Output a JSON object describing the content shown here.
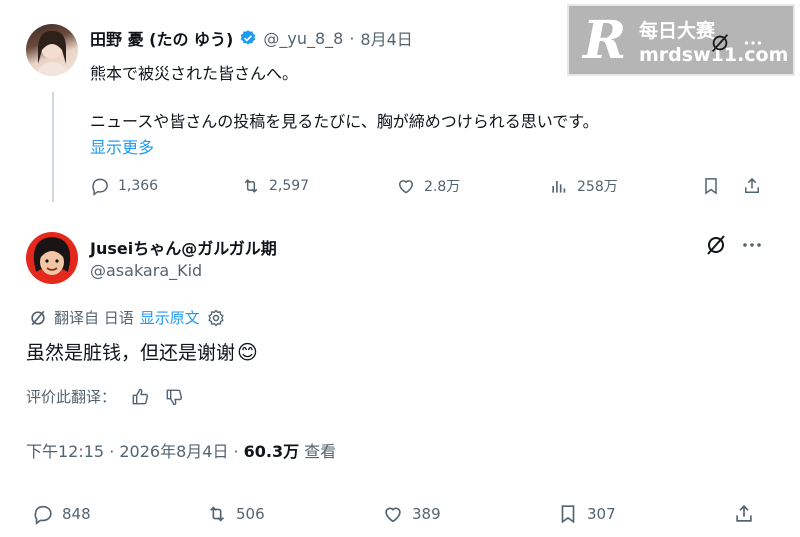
{
  "tweet": {
    "author_name": "田野 憂 (たの ゆう)",
    "handle": "@_yu_8_8",
    "separator": "·",
    "date": "8月4日",
    "text_line1": "熊本で被災された皆さんへ。",
    "text_line2": "ニュースや皆さんの投稿を見るたびに、胸が締めつけられる思いです。",
    "show_more": "显示更多",
    "replies": "1,366",
    "retweets": "2,597",
    "likes": "2.8万",
    "views": "258万"
  },
  "reply": {
    "author_name": "Juseiちゃん@ガルガル期",
    "handle": "@asakara_Kid",
    "translated_from": "翻译自 日语",
    "show_original": "显示原文",
    "text": "虽然是脏钱，但还是谢谢",
    "emoji": "😊",
    "rate_translation": "评价此翻译：",
    "time": "下午12:15 · 2026年8月4日 ·",
    "view_count": "60.3万",
    "view_label": "查看",
    "replies": "848",
    "retweets": "506",
    "likes": "389",
    "bookmarks": "307"
  },
  "watermark": {
    "logo_letter": "R",
    "title": "每日大赛",
    "url": "mrdsw11.com"
  },
  "colors": {
    "verified": "#1d9bf0",
    "link": "#1d9bf0",
    "muted": "#536471"
  }
}
